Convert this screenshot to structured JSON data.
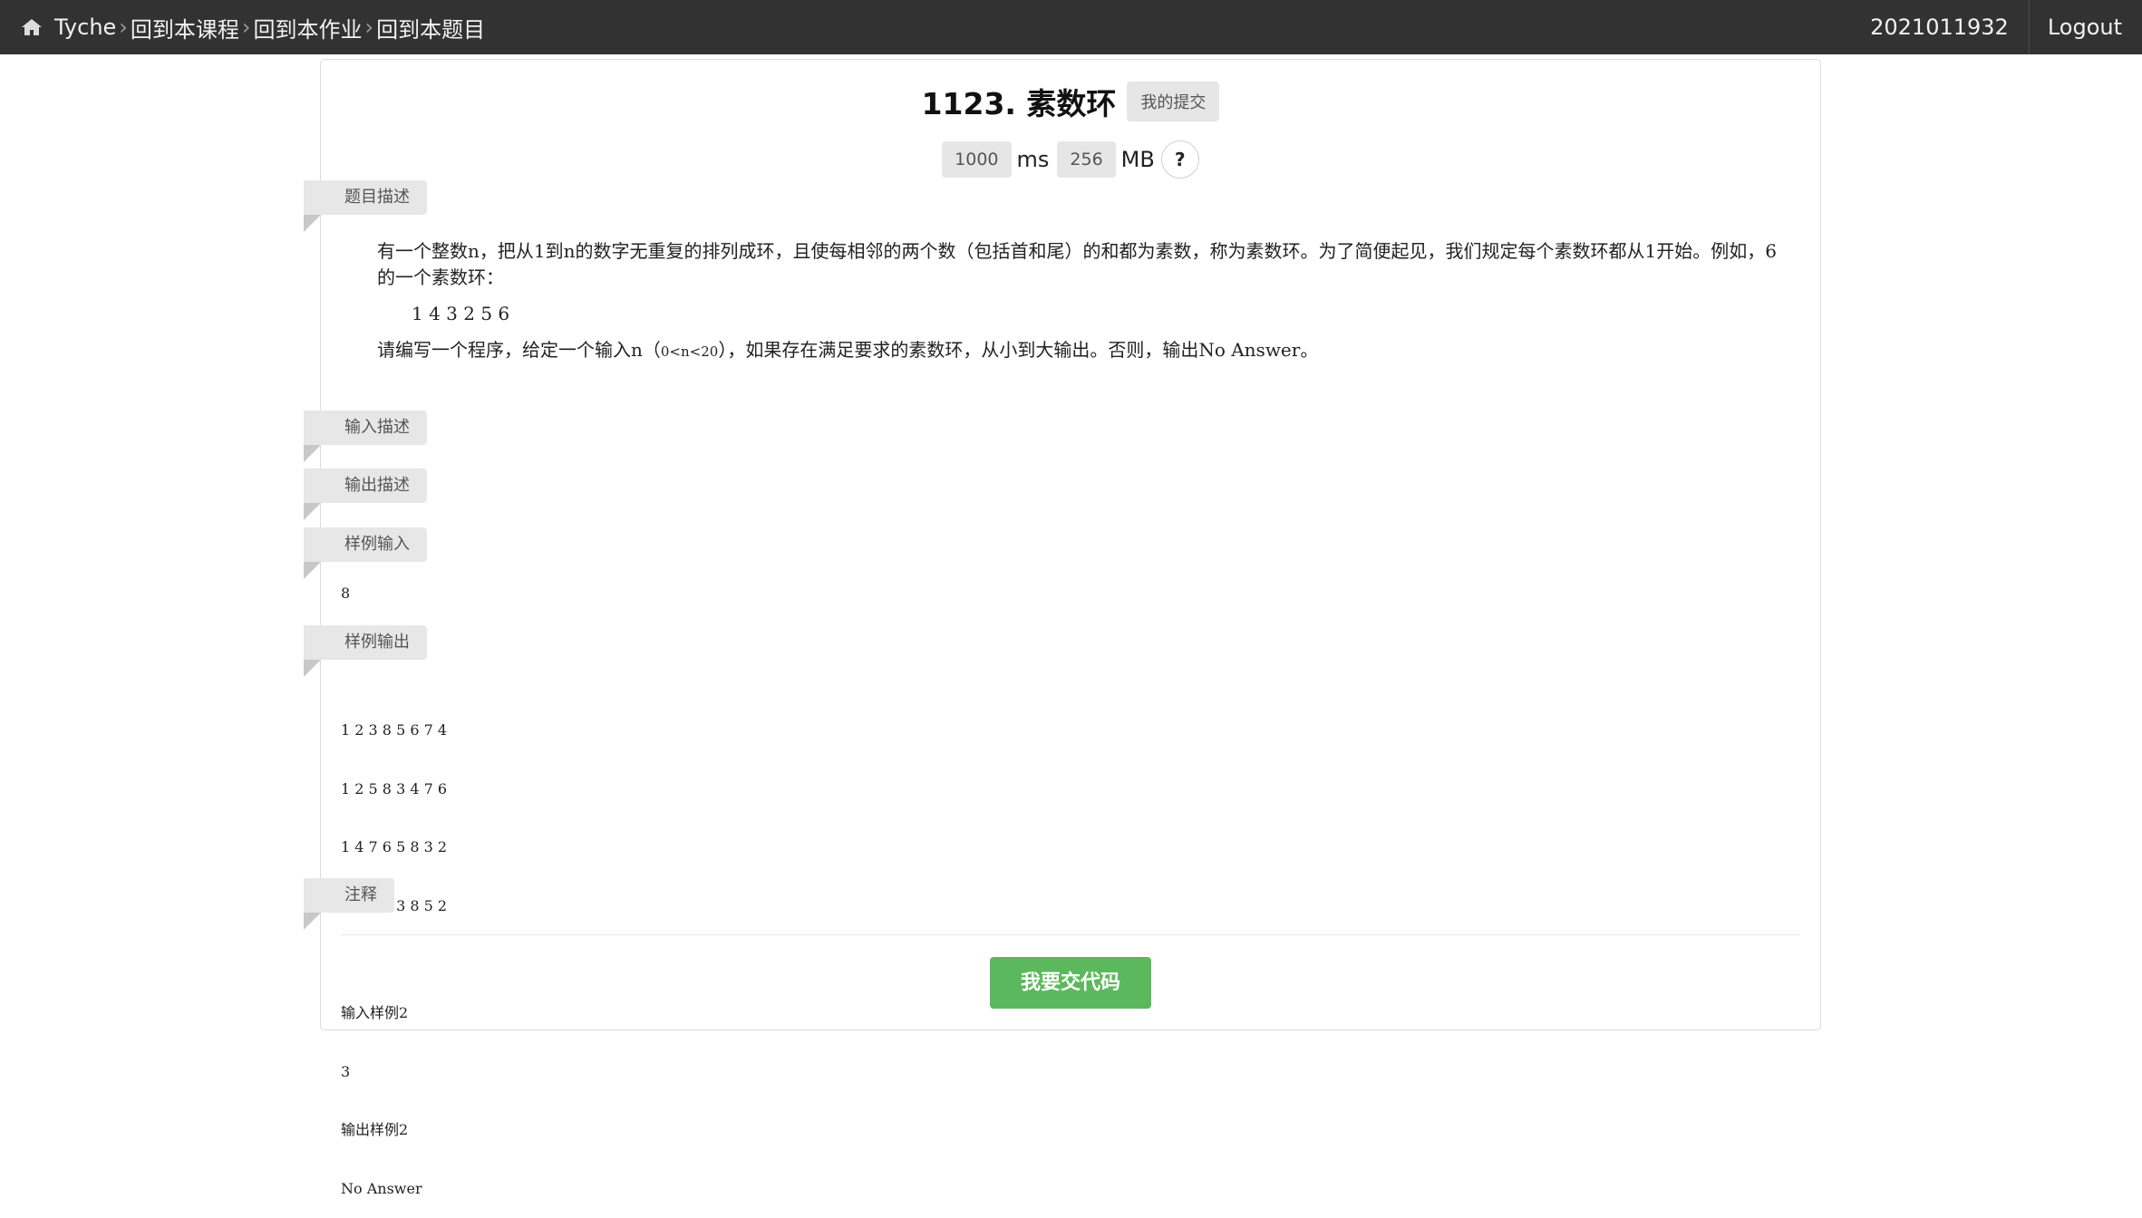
{
  "navbar": {
    "brand": "Tyche",
    "breadcrumbs": [
      "回到本课程",
      "回到本作业",
      "回到本题目"
    ],
    "user_id": "2021011932",
    "logout": "Logout"
  },
  "problem": {
    "title": "1123. 素数环",
    "my_submissions": "我的提交",
    "time_limit": "1000",
    "time_unit": "ms",
    "memory_limit": "256",
    "memory_unit": "MB",
    "help": "?"
  },
  "sections": {
    "description": "题目描述",
    "input_desc": "输入描述",
    "output_desc": "输出描述",
    "sample_input": "样例输入",
    "sample_output": "样例输出",
    "notes": "注释"
  },
  "description": {
    "p1": "有一个整数n，把从1到n的数字无重复的排列成环，且使每相邻的两个数（包括首和尾）的和都为素数，称为素数环。为了简便起见，我们规定每个素数环都从1开始。例如，6的一个素数环：",
    "example": "1 4 3 2 5 6",
    "p2_a": "请编写一个程序，给定一个输入n（",
    "p2_small": "0<n<20",
    "p2_b": "），如果存在满足要求的素数环，从小到大输出。否则，输出No Answer。"
  },
  "sample_input_text": "8",
  "sample_output_lines": [
    "1 2 3 8 5 6 7 4",
    "1 2 5 8 3 4 7 6",
    "1 4 7 6 5 8 3 2",
    "1 6 7 4 3 8 5 2",
    "",
    "输入样例2",
    "3",
    "输出样例2",
    "No Answer"
  ],
  "submit_button": "我要交代码"
}
